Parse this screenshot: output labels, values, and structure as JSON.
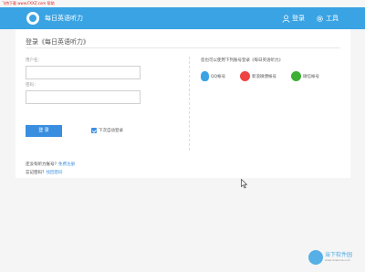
{
  "topstrip": {
    "watermark": "飞特下载 www.FXXZ.com 帮助"
  },
  "header": {
    "app_title": "每日英语听力",
    "login_label": "登录",
    "tools_label": "工具"
  },
  "login": {
    "title": "登录《每日英语听力》",
    "username_label": "用户名：",
    "password_label": "密码：",
    "username_value": "",
    "password_value": "",
    "button_label": "登 录",
    "remember_label": "下次自动登录"
  },
  "third_party": {
    "title": "您也可以使用下列账号登录《每日英语听力》",
    "items": [
      {
        "label": "QQ帐号",
        "icon": "qq-icon"
      },
      {
        "label": "新浪微博帐号",
        "icon": "weibo-icon"
      },
      {
        "label": "微信帐号",
        "icon": "wechat-icon"
      }
    ]
  },
  "footer": {
    "register_prefix": "还没有听力账号？",
    "register_link": "免费注册",
    "forgot_prefix": "忘记密码？",
    "forgot_link": "找回密码"
  },
  "corner_logo": {
    "text": "当下软件园",
    "sub": "www.downxia.com"
  },
  "colors": {
    "header": "#3aa3e3",
    "button": "#3a8ee0",
    "weibo": "#e44",
    "wechat": "#3cb034"
  }
}
